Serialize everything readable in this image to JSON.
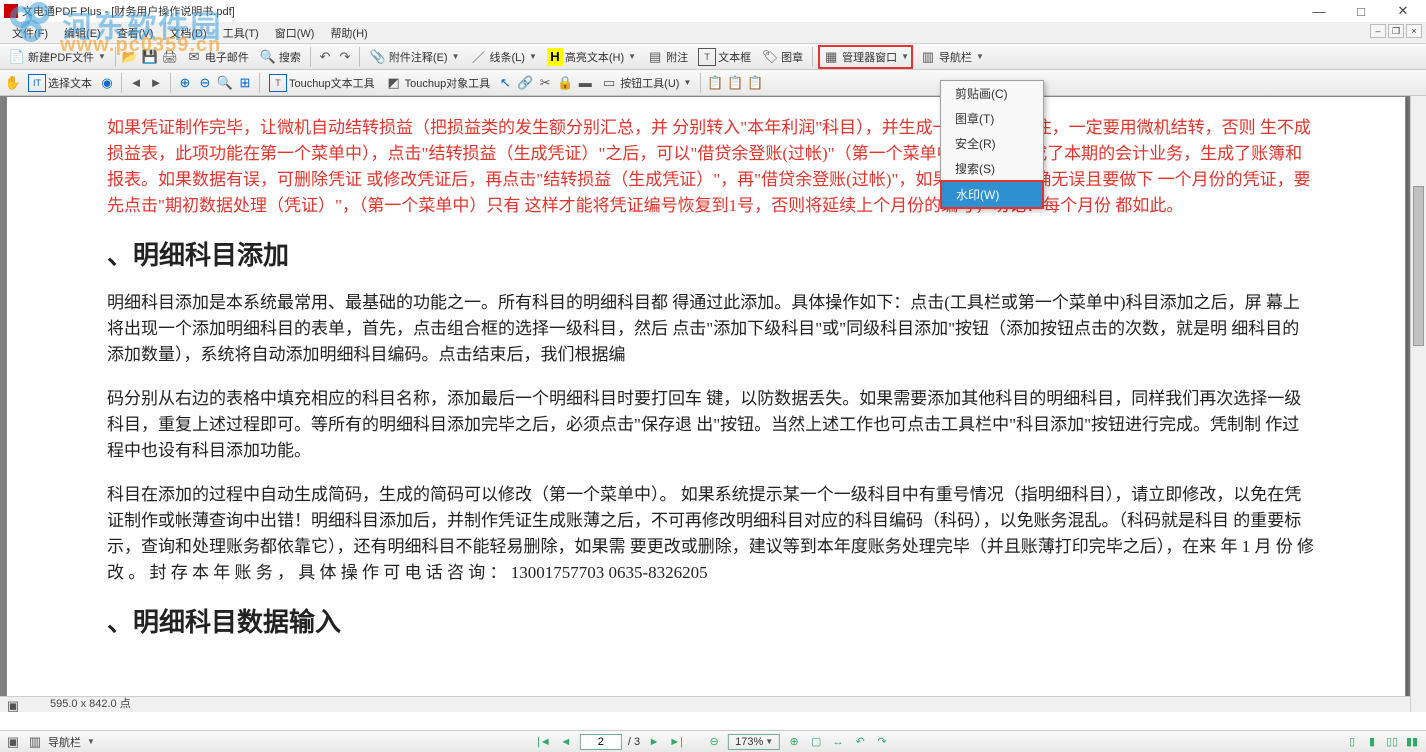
{
  "watermark": {
    "brand": "河东软件园",
    "url": "www.pc0359.cn"
  },
  "window": {
    "title": "文电通PDF Plus - [财务用户操作说明书.pdf]",
    "minimize": "—",
    "maximize": "□",
    "close": "✕"
  },
  "menubar": {
    "items": [
      "文件(F)",
      "编辑(E)",
      "查看(V)",
      "文档(D)",
      "工具(T)",
      "窗口(W)",
      "帮助(H)"
    ]
  },
  "toolbar1": {
    "new_pdf": "新建PDF文件",
    "email": "电子邮件",
    "search": "搜索",
    "attach_annot": "附件注释(E)",
    "lines": "线条(L)",
    "highlight_text": "高亮文本(H)",
    "attach": "附注",
    "textbox": "文本框",
    "stamp": "图章",
    "manager_window": "管理器窗口",
    "nav_panel": "导航栏"
  },
  "toolbar2": {
    "select_text": "选择文本",
    "touchup_text": "Touchup文本工具",
    "touchup_obj": "Touchup对象工具",
    "button_tools": "按钮工具(U)"
  },
  "dropdown": {
    "items": [
      {
        "label": "剪贴画(C)",
        "hl": false
      },
      {
        "label": "图章(T)",
        "hl": false
      },
      {
        "label": "安全(R)",
        "hl": false
      },
      {
        "label": "搜索(S)",
        "hl": false
      },
      {
        "label": "水印(W)",
        "hl": true
      }
    ]
  },
  "document": {
    "red_p1": "如果凭证制作完毕，让微机自动结转损益（把损益类的发生额分别汇总，并 分别转入\"本年利润\"科目），并生成一个凭证。记住，一定要用微机结转，否则 生不成损益表，此项功能在第一个菜单中），点击\"结转损益（生成凭证）\"之后，可以\"借贷余登账(过帐)\"（第一个菜单中），随之完成了本期的会计业务，生成了账簿和报表。如果数据有误，可删除凭证 或修改凭证后，再点击\"结转损益（生成凭证）\"，再\"借贷余登账(过帐)\"，如果本期业务正确无误且要做下 一个月份的凭证，要先点击\"期初数据处理（凭证）\"，（第一个菜单中）只有 这样才能将凭证编号恢复到1号，否则将延续上个月份的编号，切记！每个月份 都如此。",
    "h1": "、明细科目添加",
    "p2": "明细科目添加是本系统最常用、最基础的功能之一。所有科目的明细科目都 得通过此添加。具体操作如下：点击(工具栏或第一个菜单中)科目添加之后，屏 幕上将出现一个添加明细科目的表单，首先，点击组合框的选择一级科目，然后 点击\"添加下级科目\"或\"同级科目添加\"按钮（添加按钮点击的次数，就是明 细科目的添加数量），系统将自动添加明细科目编码。点击结束后，我们根据编",
    "p3": "码分别从右边的表格中填充相应的科目名称，添加最后一个明细科目时要打回车 键，以防数据丢失。如果需要添加其他科目的明细科目，同样我们再次选择一级 科目，重复上述过程即可。等所有的明细科目添加完毕之后，必须点击\"保存退 出\"按钮。当然上述工作也可点击工具栏中\"科目添加\"按钮进行完成。凭制制 作过程中也设有科目添加功能。",
    "p4": "科目在添加的过程中自动生成简码，生成的简码可以修改（第一个菜单中）。 如果系统提示某一个一级科目中有重号情况（指明细科目），请立即修改，以免在凭证制作或帐薄查询中出错！明细科目添加后，并制作凭证生成账薄之后，不可再修改明细科目对应的科目编码（科码），以免账务混乱。（科码就是科目 的重要标示，查询和处理账务都依靠它），还有明细科目不能轻易删除，如果需 要更改或删除，建议等到本年度账务处理完毕（并且账薄打印完毕之后），在来 年 1 月 份 修 改 。 封 存 本 年 账 务 ， 具 体 操 作 可 电 话 咨 询 ： 13001757703 0635-8326205",
    "h2": "、明细科目数据输入"
  },
  "status": {
    "nav_panel": "导航栏",
    "page_dim": "595.0 x 842.0 点",
    "page_current": "2",
    "page_total": "/ 3",
    "zoom": "173%"
  }
}
